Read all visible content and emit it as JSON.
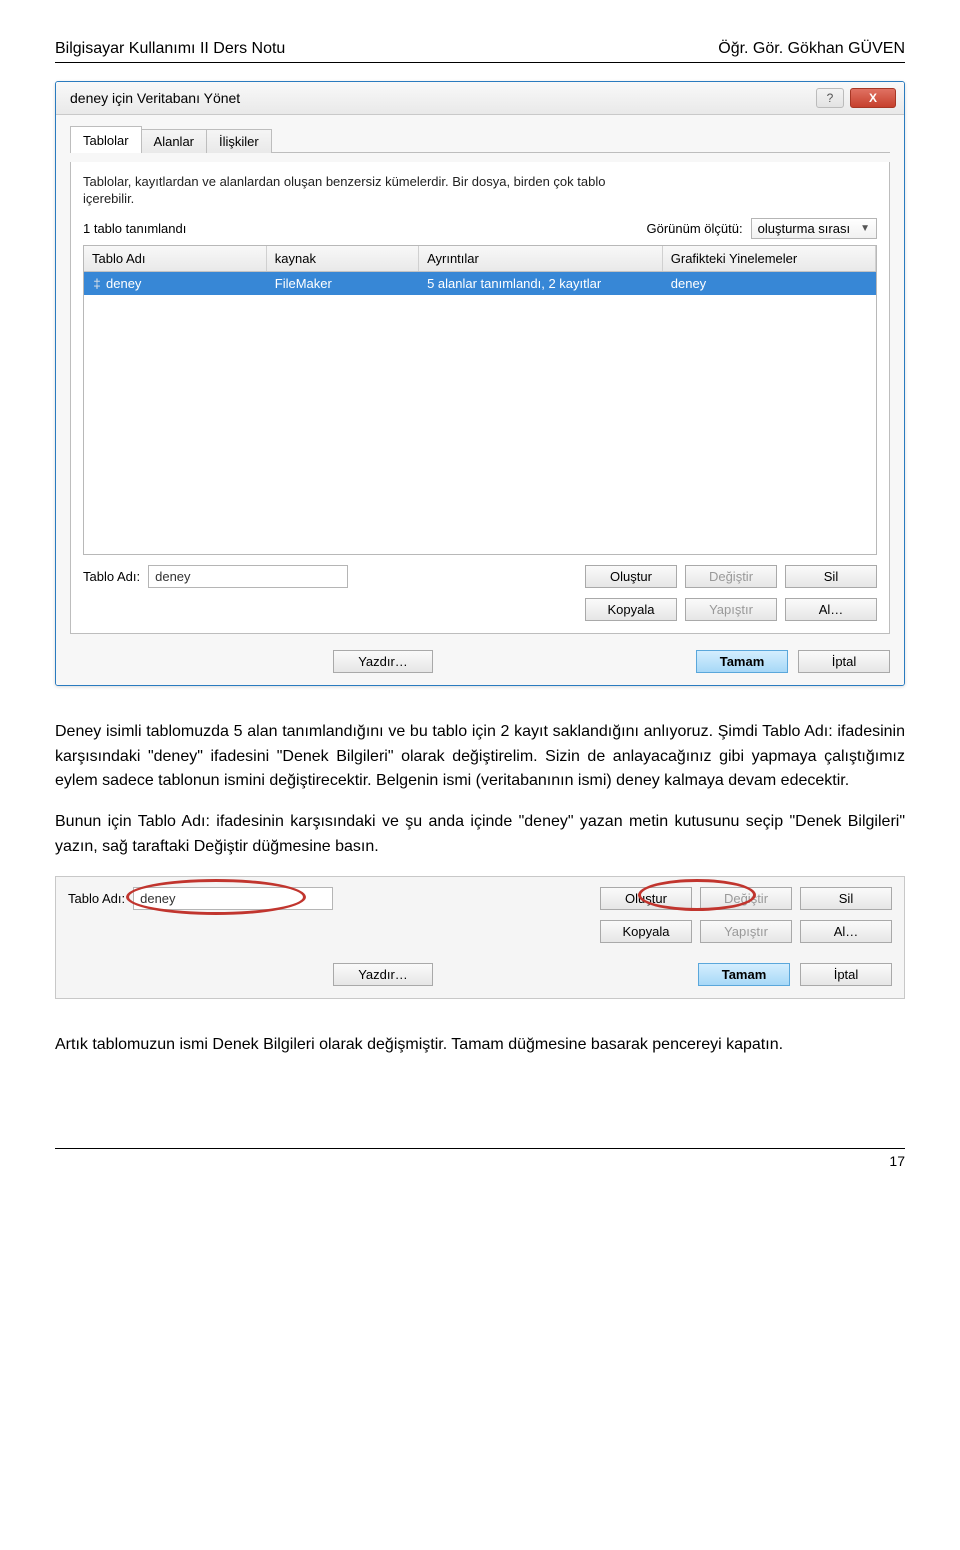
{
  "header": {
    "left": "Bilgisayar Kullanımı II Ders Notu",
    "right": "Öğr. Gör. Gökhan GÜVEN"
  },
  "dialog": {
    "title": "deney için Veritabanı Yönet",
    "help": "?",
    "close": "X",
    "tabs": {
      "tablolar": "Tablolar",
      "alanlar": "Alanlar",
      "iliskiler": "İlişkiler"
    },
    "info1": "Tablolar, kayıtlardan ve alanlardan oluşan benzersiz kümelerdir. Bir dosya, birden çok tablo içerebilir.",
    "count": "1 tablo tanımlandı",
    "viewScaleLabel": "Görünüm ölçütü:",
    "viewScaleValue": "oluşturma sırası",
    "columns": {
      "name": "Tablo Adı",
      "source": "kaynak",
      "details": "Ayrıntılar",
      "repeats": "Grafikteki Yinelemeler"
    },
    "row": {
      "name": "deney",
      "source": "FileMaker",
      "details": "5 alanlar tanımlandı, 2 kayıtlar",
      "repeats": "deney"
    },
    "tableNameLabel": "Tablo Adı:",
    "tableNameValue": "deney",
    "buttons": {
      "olustur": "Oluştur",
      "degistir": "Değiştir",
      "sil": "Sil",
      "kopyala": "Kopyala",
      "yapistir": "Yapıştır",
      "al": "Al…",
      "yazdir": "Yazdır…",
      "tamam": "Tamam",
      "iptal": "İptal"
    }
  },
  "paragraphs": {
    "p1": "Deney isimli tablomuzda 5 alan tanımlandığını ve bu tablo için 2 kayıt saklandığını anlıyoruz. Şimdi Tablo Adı: ifadesinin karşısındaki \"deney\" ifadesini \"Denek Bilgileri\" olarak değiştirelim. Sizin de anlayacağınız gibi yapmaya çalıştığımız eylem sadece tablonun ismini değiştirecektir. Belgenin ismi (veritabanının ismi) deney kalmaya devam edecektir.",
    "p2": "Bunun için Tablo Adı: ifadesinin karşısındaki ve şu anda içinde \"deney\" yazan metin kutusunu seçip \"Denek Bilgileri\" yazın, sağ taraftaki Değiştir düğmesine basın.",
    "p3": "Artık tablomuzun ismi Denek Bilgileri olarak değişmiştir. Tamam düğmesine basarak pencereyi kapatın."
  },
  "pageNumber": "17"
}
